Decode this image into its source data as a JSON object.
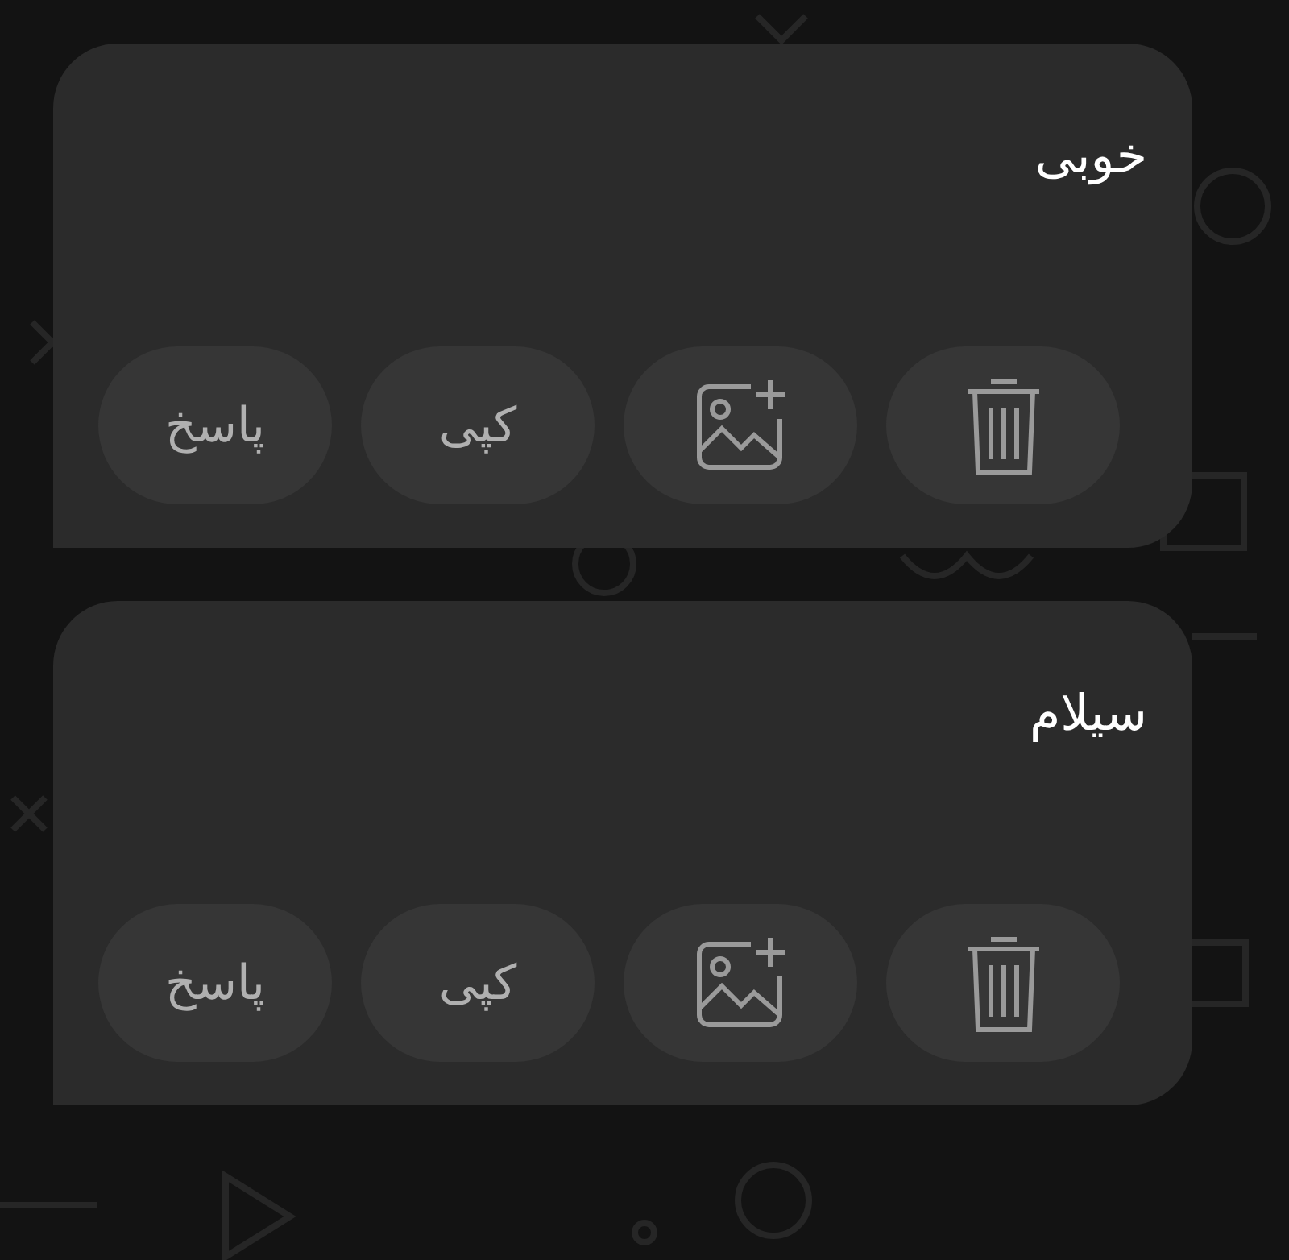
{
  "messages": [
    {
      "text": "خوبی",
      "actions": [
        {
          "kind": "delete"
        },
        {
          "kind": "add-image"
        },
        {
          "kind": "copy",
          "label": "کپی"
        },
        {
          "kind": "reply",
          "label": "پاسخ"
        }
      ]
    },
    {
      "text": "سیلام",
      "actions": [
        {
          "kind": "delete"
        },
        {
          "kind": "add-image"
        },
        {
          "kind": "copy",
          "label": "کپی"
        },
        {
          "kind": "reply",
          "label": "پاسخ"
        }
      ]
    }
  ]
}
